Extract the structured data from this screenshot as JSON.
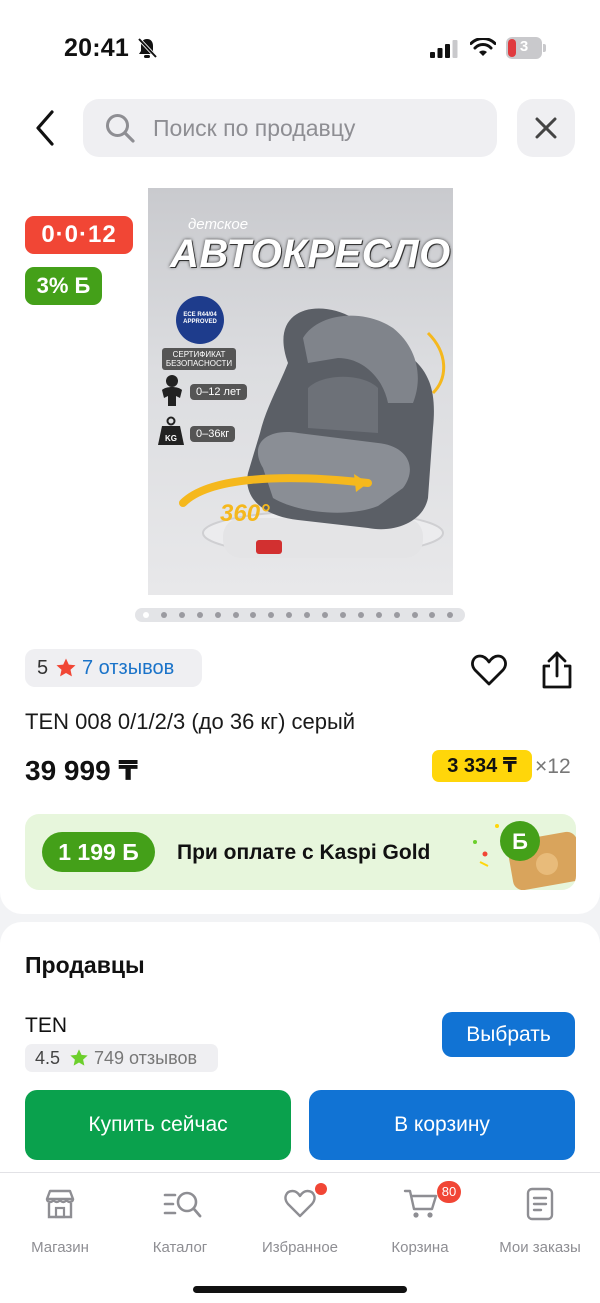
{
  "status_bar": {
    "time": "20:41",
    "battery": "3"
  },
  "search": {
    "placeholder": "Поиск по продавцу"
  },
  "badges": {
    "installment": "0·0·12",
    "bonus": "3% Б"
  },
  "product_image": {
    "kid_label": "детское",
    "title": "АВТОКРЕСЛО",
    "eu_badge": "ECE R44/04 APPROVED",
    "cert_label": "СЕРТИФИКАТ БЕЗОПАСНОСТИ",
    "age": "0–12 лет",
    "kg_icon": "KG",
    "weight": "0–36кг",
    "rotation": "360°"
  },
  "gallery": {
    "dot_count": 18,
    "active_index": 0
  },
  "rating": {
    "value": "5",
    "reviews": "7 отзывов"
  },
  "product": {
    "name": "TEN 008 0/1/2/3 (до 36 кг) серый",
    "price": "39 999 ₸",
    "monthly": "3 334 ₸",
    "multiplier": "×12"
  },
  "gold": {
    "bonus": "1 199 Б",
    "text": "При оплате с Kaspi Gold"
  },
  "sellers": {
    "title": "Продавцы",
    "seller_name": "TEN",
    "seller_rating": "4.5",
    "seller_reviews": "749 отзывов",
    "select_label": "Выбрать"
  },
  "actions": {
    "buy_now": "Купить сейчас",
    "add_to_cart": "В корзину"
  },
  "nav": {
    "items": [
      {
        "label": "Магазин",
        "icon": "store-icon"
      },
      {
        "label": "Каталог",
        "icon": "catalog-search-icon"
      },
      {
        "label": "Избранное",
        "icon": "heart-icon"
      },
      {
        "label": "Корзина",
        "icon": "cart-icon"
      },
      {
        "label": "Мои заказы",
        "icon": "orders-icon"
      }
    ],
    "cart_count": "80"
  },
  "colors": {
    "installment_badge": "#f14635",
    "bonus_green": "#44a019",
    "link_blue": "#1a73c9",
    "primary_blue": "#1173d4",
    "buy_green": "#0aa14d",
    "monthly_yellow": "#ffd60a",
    "star_red": "#f14635",
    "star_green": "#6ccf2c"
  }
}
